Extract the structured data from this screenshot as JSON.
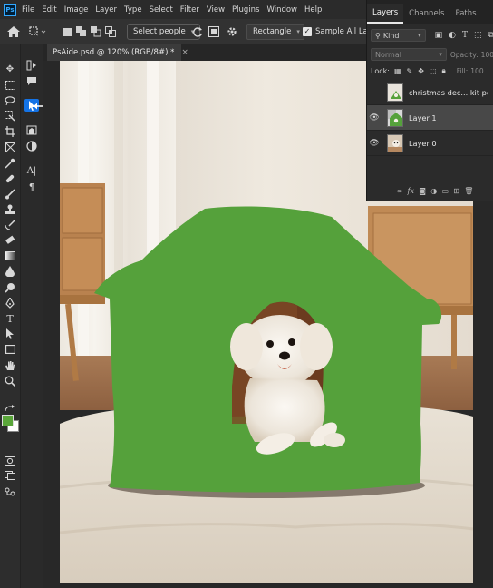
{
  "app": {
    "logo": "Ps"
  },
  "menu": [
    "File",
    "Edit",
    "Image",
    "Layer",
    "Type",
    "Select",
    "Filter",
    "View",
    "Plugins",
    "Window",
    "Help"
  ],
  "options": {
    "select_people": "Select people",
    "mode": "Rectangle",
    "sample_all_layers": "Sample All Layer"
  },
  "document": {
    "tab_title": "PsAide.psd @ 120% (RGB/8#) *",
    "close": "×"
  },
  "layers_panel": {
    "tabs": [
      "Layers",
      "Channels",
      "Paths"
    ],
    "kind": "Kind",
    "blend": "Normal",
    "opacity_label": "Opacity:",
    "opacity_value": "100",
    "lock_label": "Lock:",
    "fill_label": "Fill:",
    "fill_value": "100",
    "layers": [
      {
        "name": "christmas dec... kit pet bed",
        "visible": false,
        "selected": false
      },
      {
        "name": "Layer 1",
        "visible": true,
        "selected": true
      },
      {
        "name": "Layer 0",
        "visible": true,
        "selected": false
      }
    ],
    "footer_icons": [
      "link-icon",
      "fx-icon",
      "mask-icon",
      "adjustment-icon",
      "folder-icon",
      "new-layer-icon",
      "trash-icon"
    ]
  },
  "colors": {
    "foreground": "#5aa63a",
    "background": "#ffffff",
    "house_green": "#55a13b",
    "accent": "#1473e6"
  }
}
